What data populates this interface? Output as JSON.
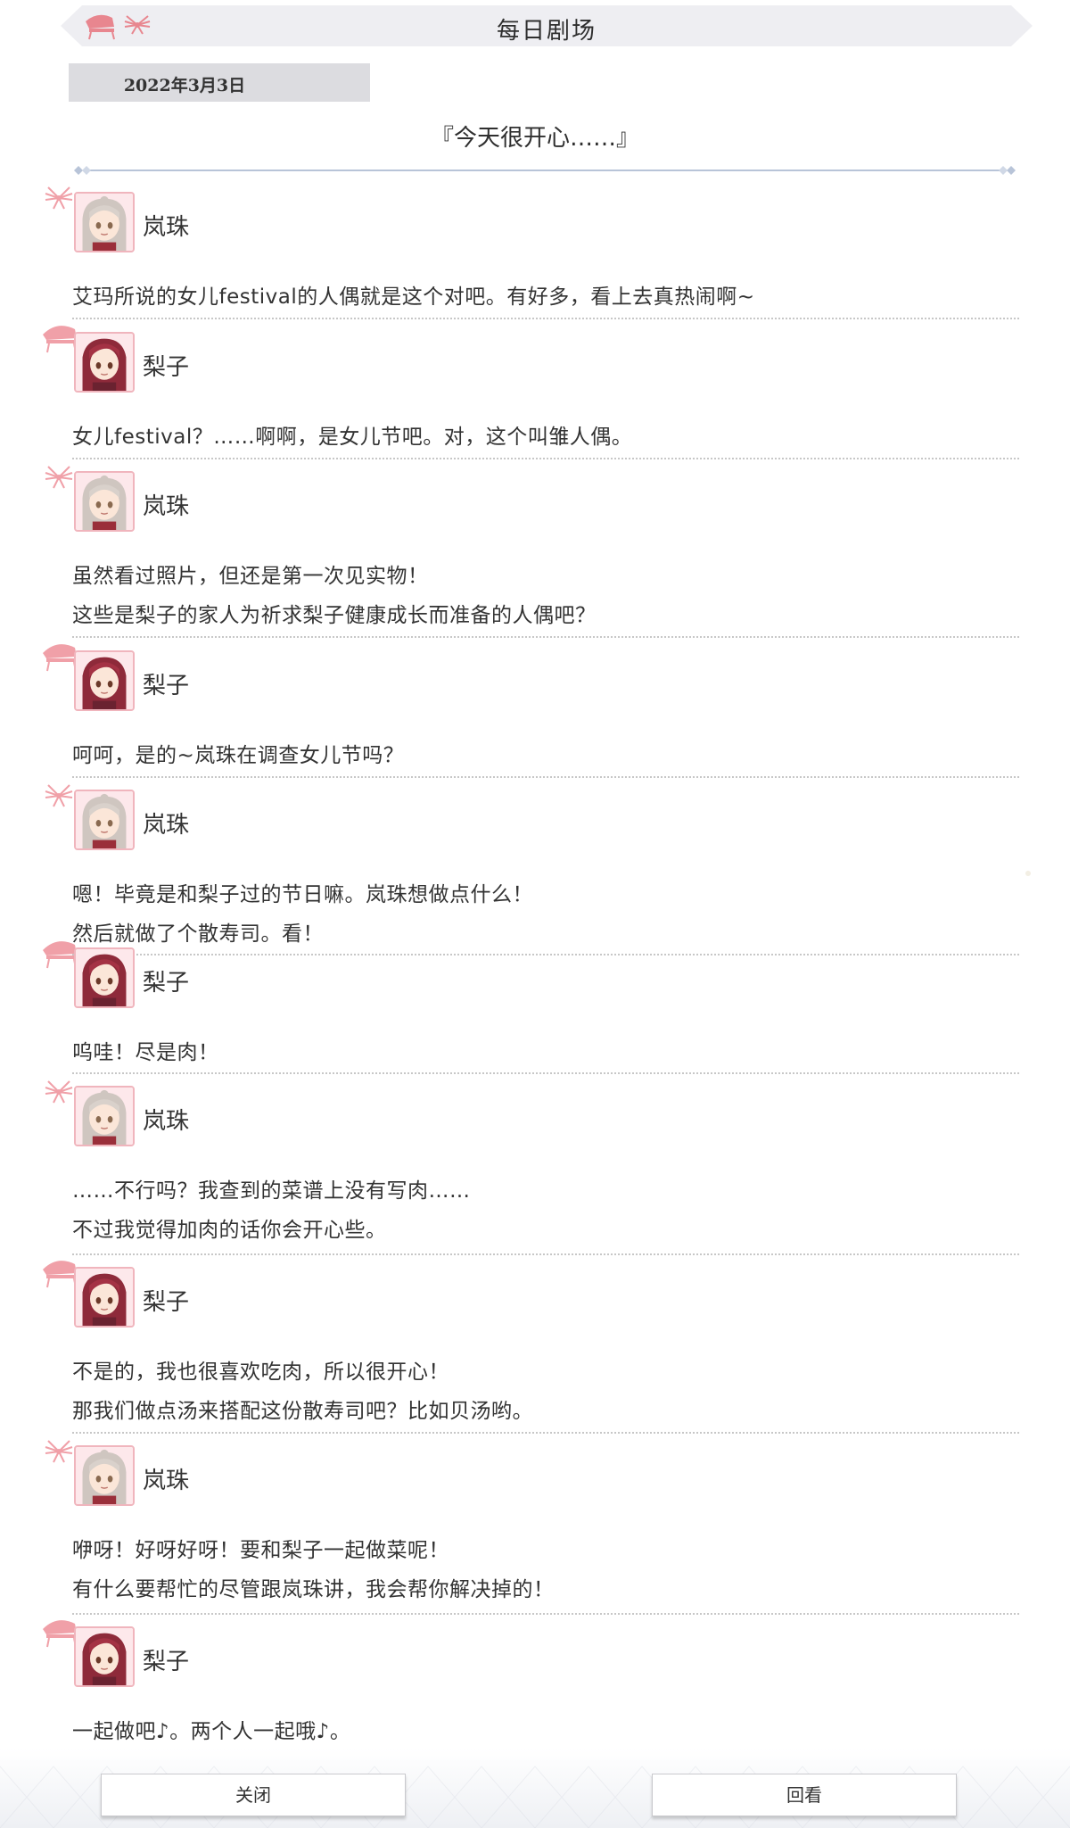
{
  "header": {
    "title": "每日剧场"
  },
  "date": "2022年3月3日",
  "episode_title": "『今天很开心……』",
  "speakers": {
    "a": "岚珠",
    "b": "梨子"
  },
  "entries": [
    {
      "who": "a",
      "speaker": "岚珠",
      "lines": [
        "艾玛所说的女儿festival的人偶就是这个对吧。有好多，看上去真热闹啊~"
      ]
    },
    {
      "who": "b",
      "speaker": "梨子",
      "lines": [
        "女儿festival？……啊啊，是女儿节吧。对，这个叫雏人偶。"
      ]
    },
    {
      "who": "a",
      "speaker": "岚珠",
      "lines": [
        "虽然看过照片，但还是第一次见实物！",
        "这些是梨子的家人为祈求梨子健康成长而准备的人偶吧？"
      ]
    },
    {
      "who": "b",
      "speaker": "梨子",
      "lines": [
        "呵呵，是的~岚珠在调查女儿节吗？"
      ]
    },
    {
      "who": "a",
      "speaker": "岚珠",
      "lines": [
        "嗯！毕竟是和梨子过的节日嘛。岚珠想做点什么！",
        "然后就做了个散寿司。看！"
      ]
    },
    {
      "who": "b",
      "speaker": "梨子",
      "lines": [
        "呜哇！尽是肉！"
      ]
    },
    {
      "who": "a",
      "speaker": "岚珠",
      "lines": [
        "……不行吗？我查到的菜谱上没有写肉……",
        "不过我觉得加肉的话你会开心些。"
      ]
    },
    {
      "who": "b",
      "speaker": "梨子",
      "lines": [
        "不是的，我也很喜欢吃肉，所以很开心！",
        "那我们做点汤来搭配这份散寿司吧？比如贝汤哟。"
      ]
    },
    {
      "who": "a",
      "speaker": "岚珠",
      "lines": [
        "咿呀！好呀好呀！要和梨子一起做菜呢！",
        "有什么要帮忙的尽管跟岚珠讲，我会帮你解决掉的！"
      ]
    },
    {
      "who": "b",
      "speaker": "梨子",
      "lines": [
        "一起做吧♪。两个人一起哦♪。"
      ]
    }
  ],
  "buttons": {
    "close": "关闭",
    "review": "回看"
  },
  "colors": {
    "accent_pink": "#f0a0a8",
    "header_bg": "#eeeef2",
    "date_bg": "#dcdce0",
    "divider_blue": "#b8c4d8"
  }
}
